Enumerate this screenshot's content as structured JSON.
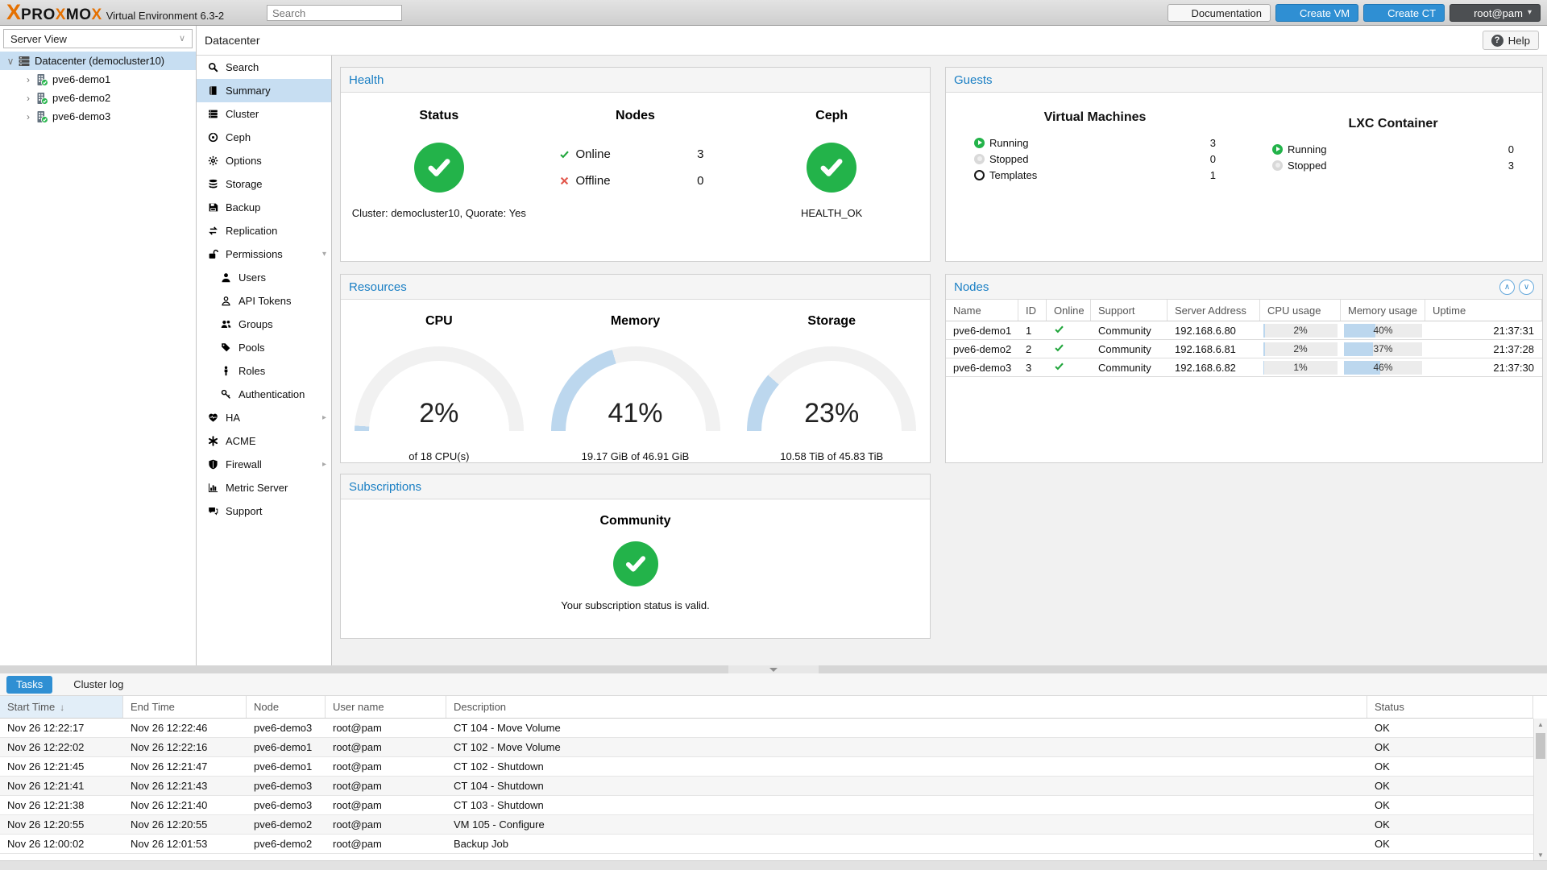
{
  "colors": {
    "orange": "#e57000",
    "accent": "#2f8fd3",
    "panel-title": "#1a7fc4",
    "green": "#23b34a",
    "red": "#e2574c",
    "gauge-fill": "#bcd7ee",
    "selection": "#c7def2"
  },
  "header": {
    "brand": "PROXMOX",
    "subtitle": "Virtual Environment 6.3-2",
    "search_placeholder": "Search",
    "documentation_label": "Documentation",
    "create_vm_label": "Create VM",
    "create_ct_label": "Create CT",
    "user_label": "root@pam"
  },
  "tree": {
    "view_selector": "Server View",
    "items": [
      {
        "label": "Datacenter (democluster10)",
        "icon": "server-icon",
        "level": 0,
        "expander": "∨",
        "selected": true
      },
      {
        "label": "pve6-demo1",
        "icon": "node-icon",
        "level": 1,
        "expander": "›",
        "selected": false
      },
      {
        "label": "pve6-demo2",
        "icon": "node-icon",
        "level": 1,
        "expander": "›",
        "selected": false
      },
      {
        "label": "pve6-demo3",
        "icon": "node-icon",
        "level": 1,
        "expander": "›",
        "selected": false
      }
    ]
  },
  "breadcrumb": {
    "title": "Datacenter",
    "help_label": "Help"
  },
  "menu": {
    "items": [
      {
        "label": "Search",
        "icon": "search-icon"
      },
      {
        "label": "Summary",
        "icon": "book-icon",
        "selected": true
      },
      {
        "label": "Cluster",
        "icon": "cluster-icon"
      },
      {
        "label": "Ceph",
        "icon": "ceph-icon"
      },
      {
        "label": "Options",
        "icon": "gear-icon"
      },
      {
        "label": "Storage",
        "icon": "storage-icon"
      },
      {
        "label": "Backup",
        "icon": "backup-icon"
      },
      {
        "label": "Replication",
        "icon": "replication-icon"
      },
      {
        "label": "Permissions",
        "icon": "unlock-icon",
        "arrow": "down"
      },
      {
        "label": "Users",
        "icon": "user-icon",
        "indent": true
      },
      {
        "label": "API Tokens",
        "icon": "user-outline-icon",
        "indent": true
      },
      {
        "label": "Groups",
        "icon": "users-icon",
        "indent": true
      },
      {
        "label": "Pools",
        "icon": "tag-icon",
        "indent": true
      },
      {
        "label": "Roles",
        "icon": "person-icon",
        "indent": true
      },
      {
        "label": "Authentication",
        "icon": "key-icon",
        "indent": true
      },
      {
        "label": "HA",
        "icon": "heartbeat-icon",
        "arrow": "right"
      },
      {
        "label": "ACME",
        "icon": "asterisk-icon"
      },
      {
        "label": "Firewall",
        "icon": "shield-icon",
        "arrow": "right"
      },
      {
        "label": "Metric Server",
        "icon": "chart-icon"
      },
      {
        "label": "Support",
        "icon": "support-icon"
      }
    ]
  },
  "health": {
    "title": "Health",
    "status_heading": "Status",
    "status_caption": "Cluster: democluster10, Quorate: Yes",
    "nodes_heading": "Nodes",
    "node_states": [
      {
        "label": "Online",
        "count": "3",
        "icon": "check-icon"
      },
      {
        "label": "Offline",
        "count": "0",
        "icon": "cross-icon"
      }
    ],
    "ceph_heading": "Ceph",
    "ceph_status": "HEALTH_OK"
  },
  "guests": {
    "title": "Guests",
    "vm_heading": "Virtual Machines",
    "vm_rows": [
      {
        "label": "Running",
        "value": "3",
        "icon": "running"
      },
      {
        "label": "Stopped",
        "value": "0",
        "icon": "stopped"
      },
      {
        "label": "Templates",
        "value": "1",
        "icon": "template"
      }
    ],
    "lxc_heading": "LXC Container",
    "lxc_rows": [
      {
        "label": "Running",
        "value": "0",
        "icon": "running"
      },
      {
        "label": "Stopped",
        "value": "3",
        "icon": "stopped"
      }
    ]
  },
  "resources": {
    "title": "Resources",
    "gauges": [
      {
        "heading": "CPU",
        "percent": 2,
        "display": "2%",
        "caption": "of 18 CPU(s)"
      },
      {
        "heading": "Memory",
        "percent": 41,
        "display": "41%",
        "caption": "19.17 GiB of 46.91 GiB"
      },
      {
        "heading": "Storage",
        "percent": 23,
        "display": "23%",
        "caption": "10.58 TiB of 45.83 TiB"
      }
    ]
  },
  "nodes_table": {
    "title": "Nodes",
    "columns": [
      "Name",
      "ID",
      "Online",
      "Support",
      "Server Address",
      "CPU usage",
      "Memory usage",
      "Uptime"
    ],
    "rows": [
      {
        "name": "pve6-demo1",
        "id": "1",
        "online": true,
        "support": "Community",
        "address": "192.168.6.80",
        "cpu": "2%",
        "cpu_pct": 2,
        "mem": "40%",
        "mem_pct": 40,
        "uptime": "21:37:31"
      },
      {
        "name": "pve6-demo2",
        "id": "2",
        "online": true,
        "support": "Community",
        "address": "192.168.6.81",
        "cpu": "2%",
        "cpu_pct": 2,
        "mem": "37%",
        "mem_pct": 37,
        "uptime": "21:37:28"
      },
      {
        "name": "pve6-demo3",
        "id": "3",
        "online": true,
        "support": "Community",
        "address": "192.168.6.82",
        "cpu": "1%",
        "cpu_pct": 1,
        "mem": "46%",
        "mem_pct": 46,
        "uptime": "21:37:30"
      }
    ]
  },
  "subscriptions": {
    "title": "Subscriptions",
    "heading": "Community",
    "message": "Your subscription status is valid."
  },
  "tasks": {
    "tabs": [
      {
        "label": "Tasks",
        "active": true
      },
      {
        "label": "Cluster log",
        "active": false
      }
    ],
    "columns": [
      "Start Time",
      "End Time",
      "Node",
      "User name",
      "Description",
      "Status"
    ],
    "sort": {
      "column_index": 0,
      "arrow": "↓"
    },
    "rows": [
      [
        "Nov 26 12:22:17",
        "Nov 26 12:22:46",
        "pve6-demo3",
        "root@pam",
        "CT 104 - Move Volume",
        "OK"
      ],
      [
        "Nov 26 12:22:02",
        "Nov 26 12:22:16",
        "pve6-demo1",
        "root@pam",
        "CT 102 - Move Volume",
        "OK"
      ],
      [
        "Nov 26 12:21:45",
        "Nov 26 12:21:47",
        "pve6-demo1",
        "root@pam",
        "CT 102 - Shutdown",
        "OK"
      ],
      [
        "Nov 26 12:21:41",
        "Nov 26 12:21:43",
        "pve6-demo3",
        "root@pam",
        "CT 104 - Shutdown",
        "OK"
      ],
      [
        "Nov 26 12:21:38",
        "Nov 26 12:21:40",
        "pve6-demo3",
        "root@pam",
        "CT 103 - Shutdown",
        "OK"
      ],
      [
        "Nov 26 12:20:55",
        "Nov 26 12:20:55",
        "pve6-demo2",
        "root@pam",
        "VM 105 - Configure",
        "OK"
      ],
      [
        "Nov 26 12:00:02",
        "Nov 26 12:01:53",
        "pve6-demo2",
        "root@pam",
        "Backup Job",
        "OK"
      ]
    ]
  }
}
